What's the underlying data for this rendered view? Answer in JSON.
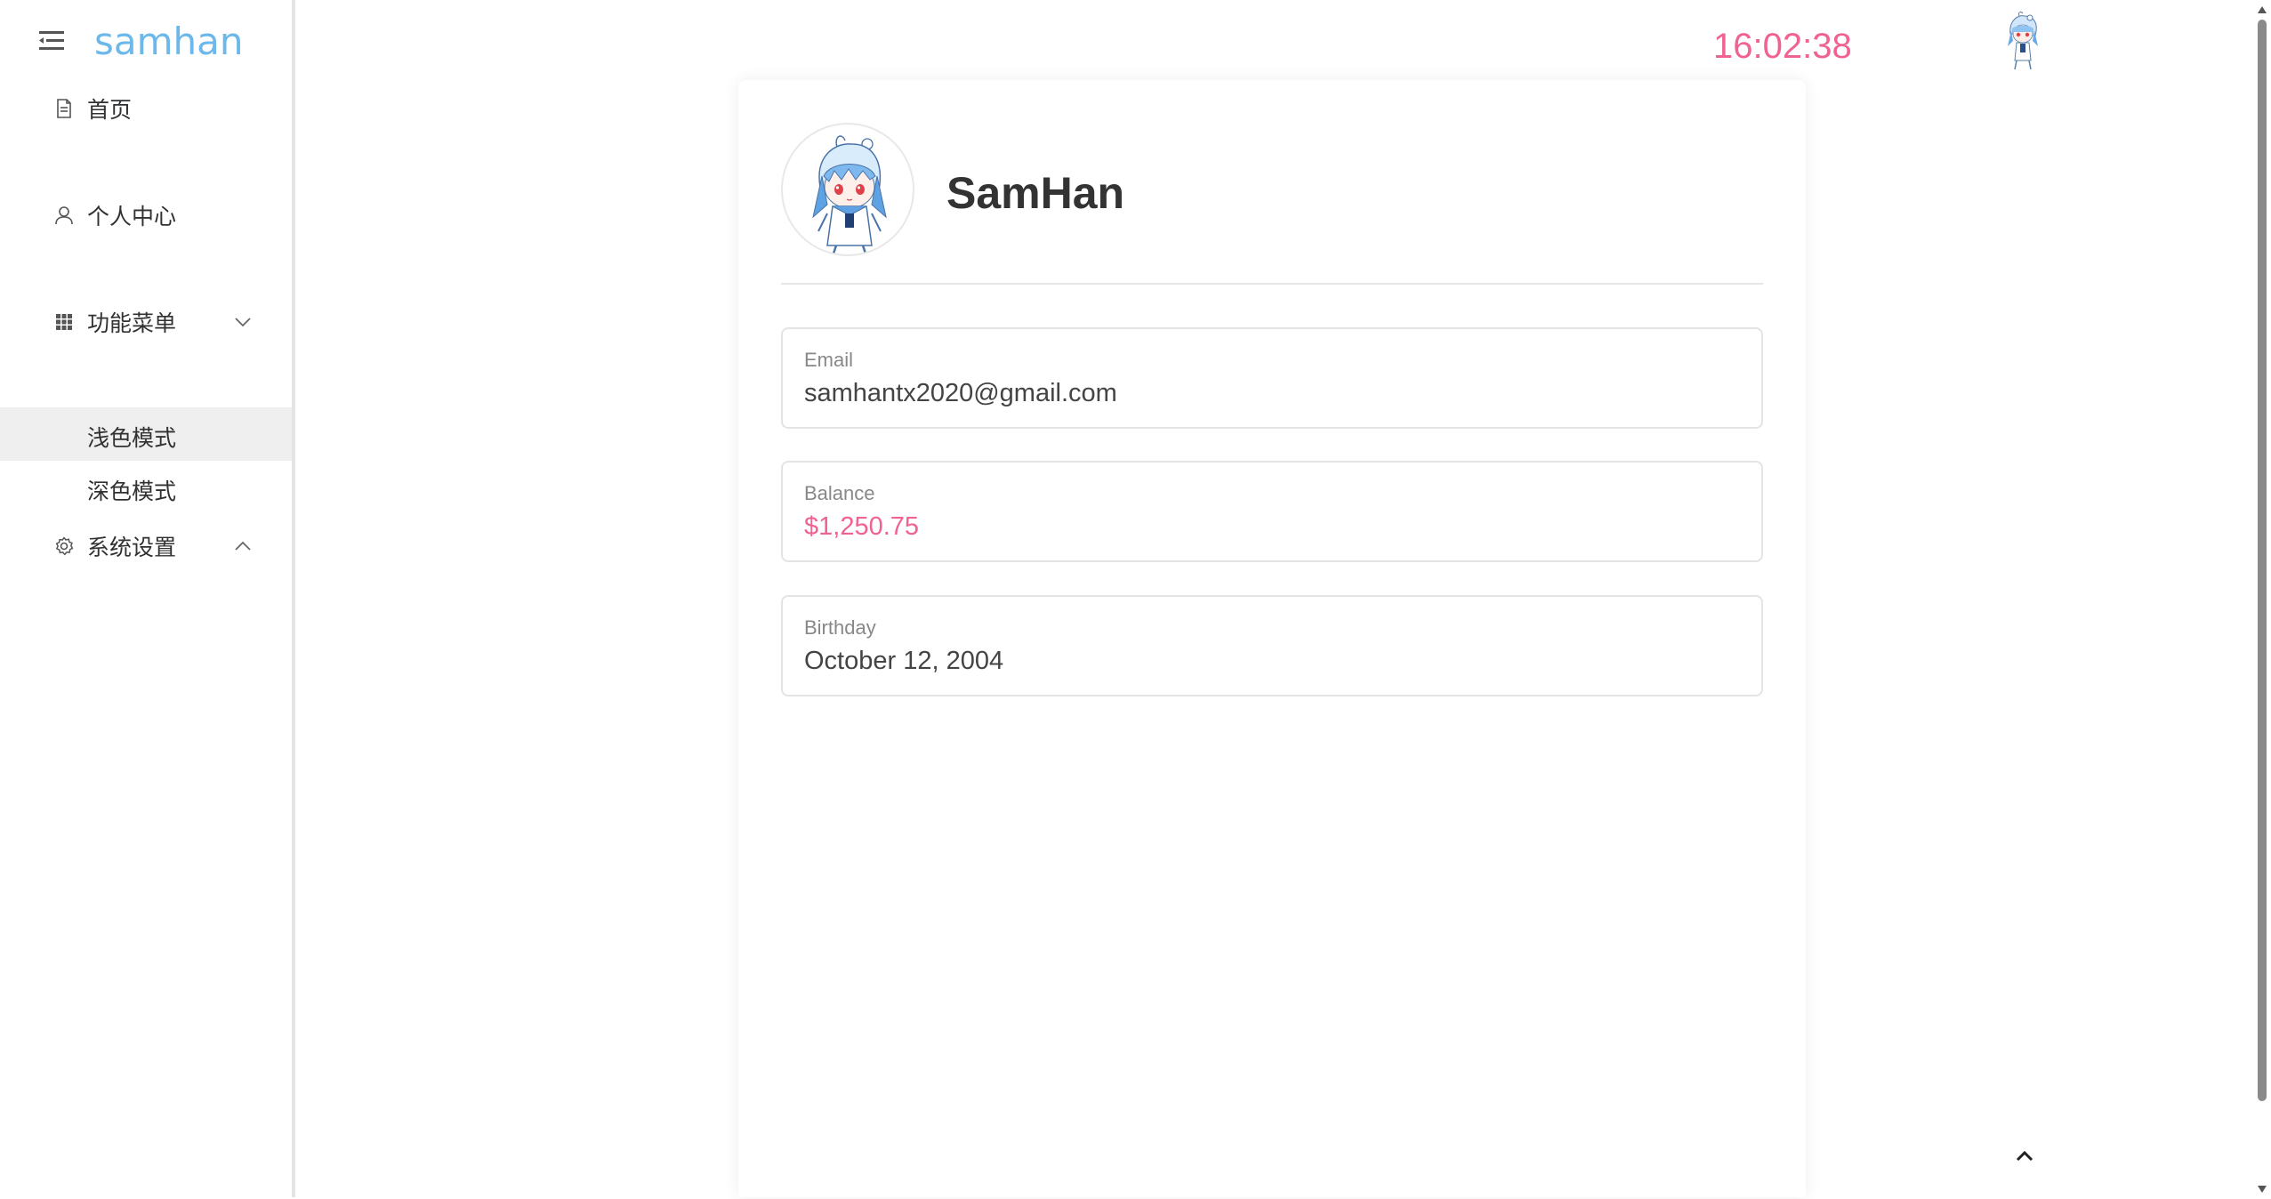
{
  "sidebar": {
    "logo": "samhan",
    "items": [
      {
        "label": "首页",
        "icon": "document-icon"
      },
      {
        "label": "个人中心",
        "icon": "user-icon"
      },
      {
        "label": "功能菜单",
        "icon": "grid-icon",
        "expanded": false
      },
      {
        "label": "系统设置",
        "icon": "gear-icon",
        "expanded": true
      }
    ],
    "subitems": [
      {
        "label": "浅色模式",
        "active": true
      },
      {
        "label": "深色模式",
        "active": false
      }
    ]
  },
  "header": {
    "time": "16:02:38"
  },
  "profile": {
    "name": "SamHan",
    "fields": [
      {
        "label": "Email",
        "value": "samhantx2020@gmail.com"
      },
      {
        "label": "Balance",
        "value": "$1,250.75"
      },
      {
        "label": "Birthday",
        "value": "October 12, 2004"
      }
    ]
  },
  "colors": {
    "accent_pink": "#f06292",
    "logo_blue": "#6cb8ea",
    "active_bg": "#efefef"
  }
}
